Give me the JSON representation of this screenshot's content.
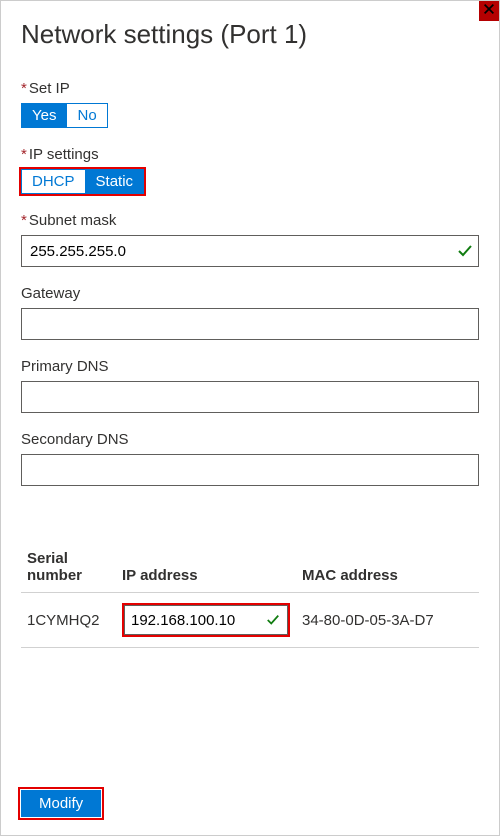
{
  "title": "Network settings (Port 1)",
  "setIp": {
    "label": "Set IP",
    "required": true,
    "options": [
      "Yes",
      "No"
    ],
    "selected": "Yes"
  },
  "ipSettings": {
    "label": "IP settings",
    "required": true,
    "options": [
      "DHCP",
      "Static"
    ],
    "selected": "Static",
    "highlighted": true
  },
  "subnetMask": {
    "label": "Subnet mask",
    "required": true,
    "value": "255.255.255.0",
    "valid": true
  },
  "gateway": {
    "label": "Gateway",
    "value": ""
  },
  "primaryDns": {
    "label": "Primary DNS",
    "value": ""
  },
  "secondaryDns": {
    "label": "Secondary DNS",
    "value": ""
  },
  "table": {
    "headers": {
      "serial": "Serial number",
      "ip": "IP address",
      "mac": "MAC address"
    },
    "rows": [
      {
        "serial": "1CYMHQ2",
        "ip": "192.168.100.10",
        "ipValid": true,
        "ipHighlighted": true,
        "mac": "34-80-0D-05-3A-D7"
      }
    ]
  },
  "buttons": {
    "modify": "Modify"
  }
}
